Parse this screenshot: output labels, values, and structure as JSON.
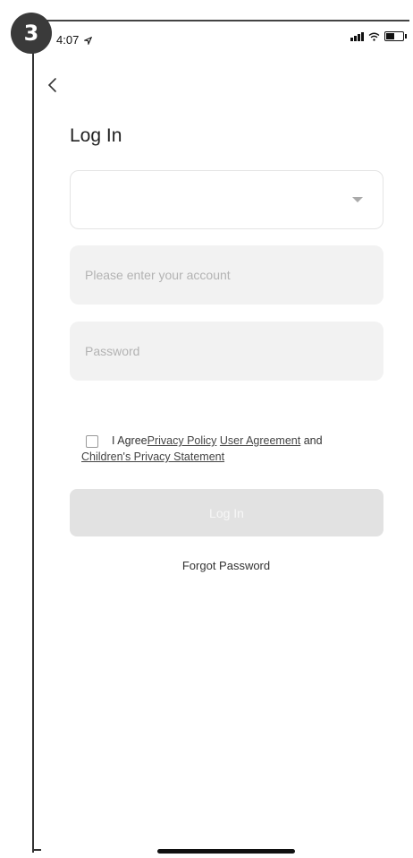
{
  "step": {
    "number": "3"
  },
  "status_bar": {
    "time": "4:07",
    "location_icon": "location-arrow-icon",
    "signal_icon": "signal-icon",
    "wifi_icon": "wifi-icon",
    "battery_icon": "battery-icon"
  },
  "nav": {
    "back_icon": "chevron-left-icon"
  },
  "page": {
    "title": "Log In"
  },
  "form": {
    "region_select": {
      "value": "",
      "caret_icon": "caret-down-icon"
    },
    "account": {
      "placeholder": "Please enter your account",
      "value": ""
    },
    "password": {
      "placeholder": "Password",
      "value": ""
    }
  },
  "agreement": {
    "prefix": "I Agree",
    "privacy_policy": "Privacy Policy",
    "user_agreement": "User Agreement",
    "and": "and",
    "childrens_privacy": "Children's Privacy Statement",
    "checked": false
  },
  "actions": {
    "login_label": "Log In",
    "forgot_label": "Forgot Password"
  },
  "colors": {
    "button_disabled": "#e2e2e2",
    "input_bg": "#f2f2f2",
    "text": "#222222"
  }
}
